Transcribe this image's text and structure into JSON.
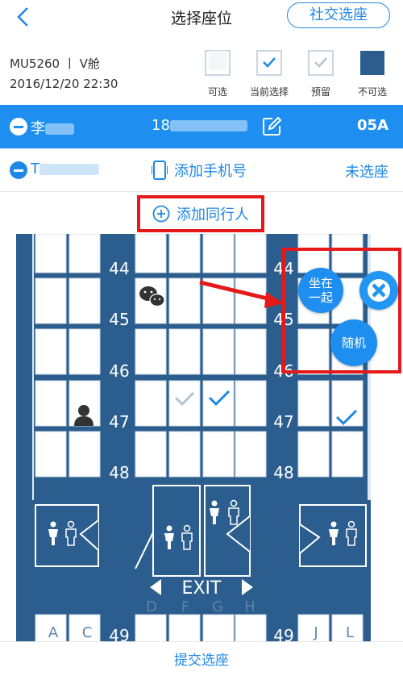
{
  "header": {
    "title": "选择座位",
    "social_button": "社交选座"
  },
  "flight": {
    "number_class": "MU5260 丨 V舱",
    "datetime": "2016/12/20  22:30"
  },
  "legend": [
    {
      "label": "可选"
    },
    {
      "label": "当前选择"
    },
    {
      "label": "预留"
    },
    {
      "label": "不可选"
    }
  ],
  "passengers": {
    "p1": {
      "name": "李",
      "phone": "18",
      "seat": "05A"
    },
    "p2": {
      "name": "T",
      "add_phone": "添加手机号",
      "status": "未选座"
    }
  },
  "add_companion": "添加同行人",
  "cabin": {
    "rows": [
      "44",
      "45",
      "46",
      "47",
      "48",
      "49"
    ],
    "exit_label": "EXIT",
    "seat_letters_left": [
      "A",
      "C"
    ],
    "seat_letters_middle": [
      "D",
      "F",
      "G",
      "H"
    ],
    "seat_letters_right": [
      "J",
      "L"
    ]
  },
  "popup": {
    "together": "坐在\n一起",
    "together_l1": "坐在",
    "together_l2": "一起",
    "random": "随机"
  },
  "bottom": {
    "submit": "提交选座"
  },
  "colors": {
    "accent": "#1e8ff0",
    "cabin": "#2b5e8e",
    "annotation": "#e41a1a"
  }
}
